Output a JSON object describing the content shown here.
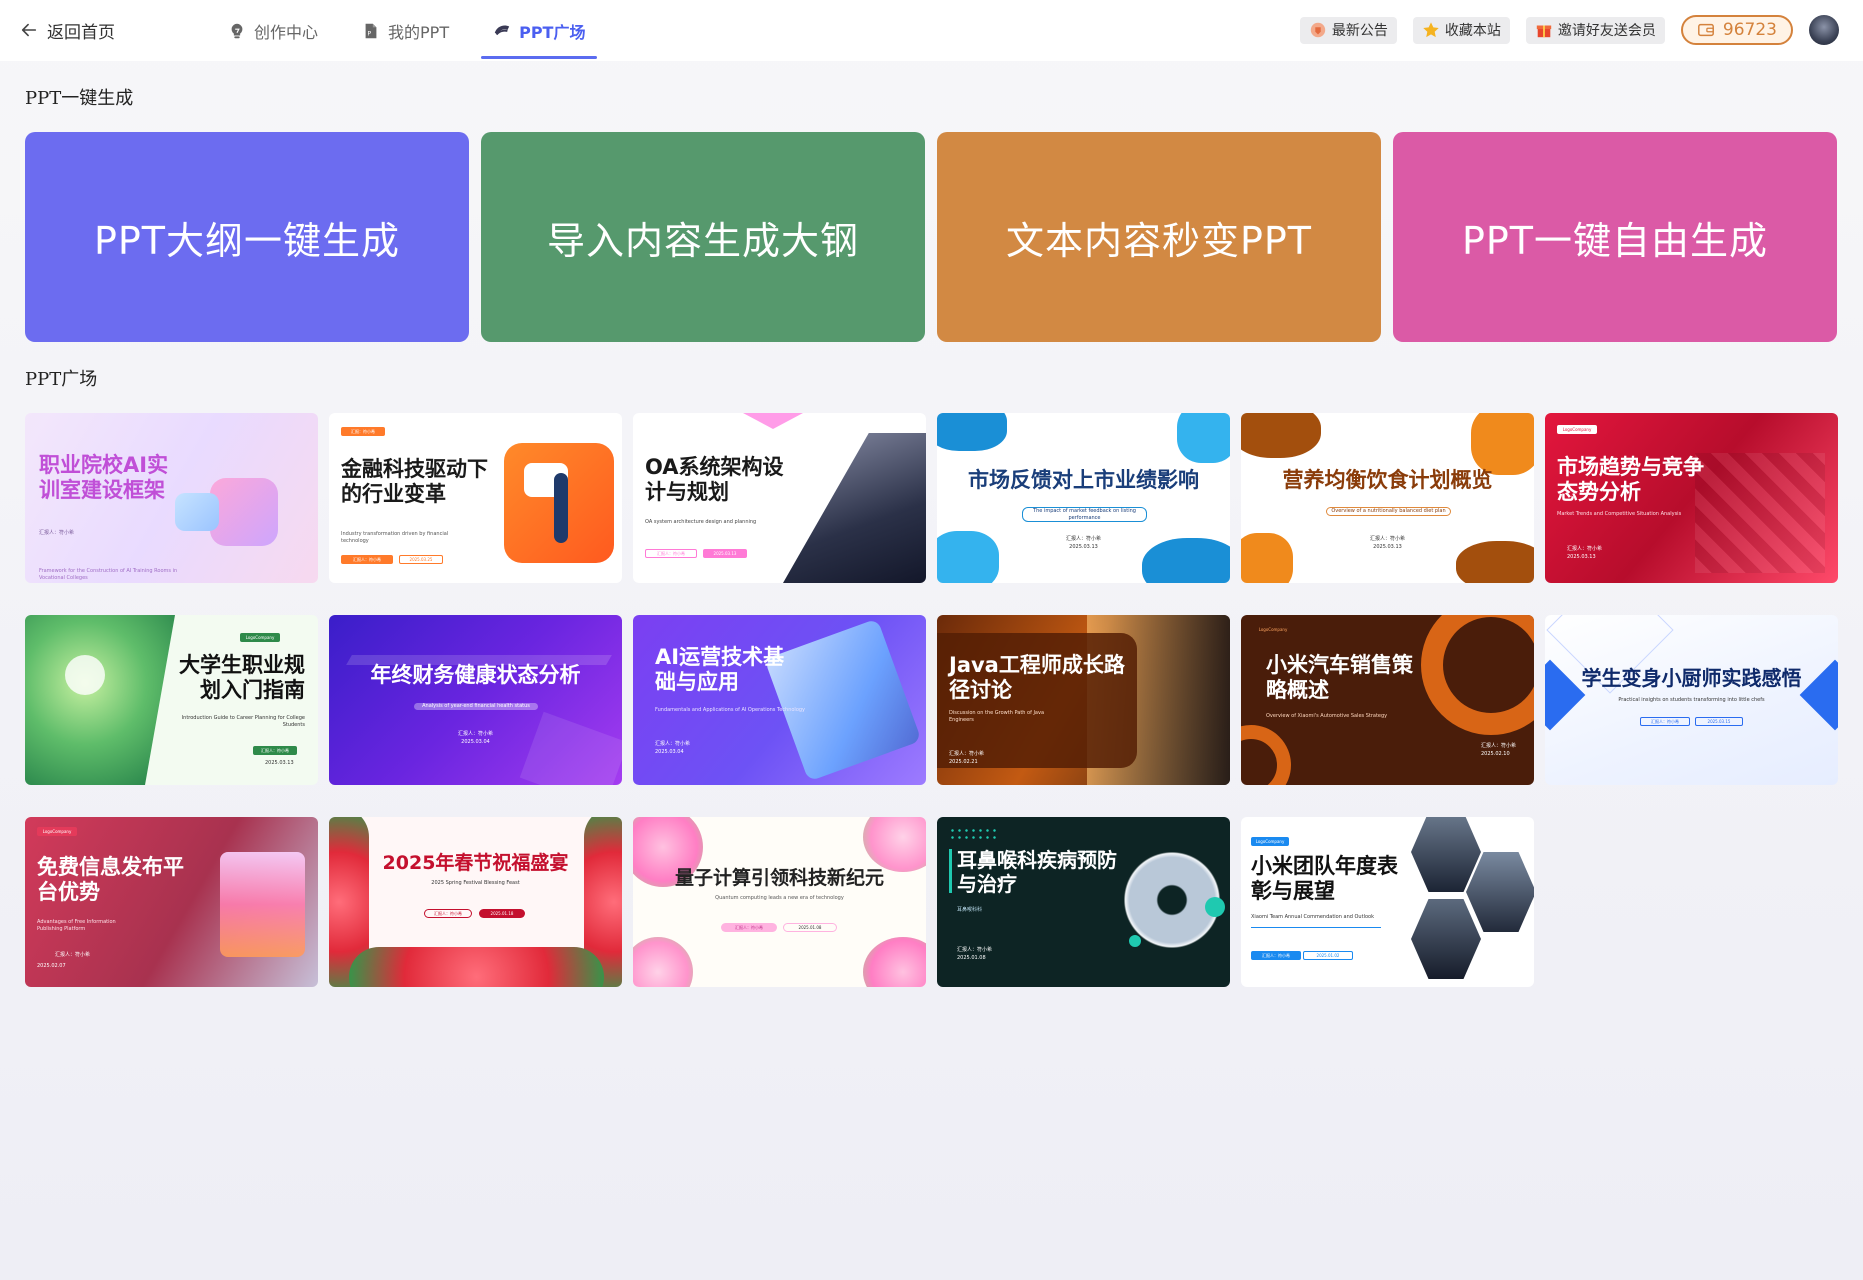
{
  "topbar": {
    "back_label": "返回首页",
    "nav": [
      {
        "label": "创作中心",
        "icon": "bulb-icon",
        "active": false
      },
      {
        "label": "我的PPT",
        "icon": "document-icon",
        "active": false
      },
      {
        "label": "PPT广场",
        "icon": "square-icon",
        "active": true
      }
    ],
    "tools": [
      {
        "label": "最新公告",
        "icon": "announcement-icon"
      },
      {
        "label": "收藏本站",
        "icon": "star-icon"
      },
      {
        "label": "邀请好友送会员",
        "icon": "gift-icon"
      }
    ],
    "points": "96723"
  },
  "generate_section": {
    "title": "PPT一键生成",
    "cards": [
      {
        "label": "PPT大纲一键生成",
        "color": "#6c6cf0"
      },
      {
        "label": "导入内容生成大钢",
        "color": "#56996d"
      },
      {
        "label": "文本内容秒变PPT",
        "color": "#d28943"
      },
      {
        "label": "PPT一键自由生成",
        "color": "#db5aa6"
      }
    ]
  },
  "square_section": {
    "title": "PPT广场",
    "templates": [
      {
        "title": "职业院校AI实训室建设框架",
        "subtitle": "Framework for the Construction of AI Training Rooms in Vocational Colleges",
        "reporter": "汇报人：符小希",
        "date": ""
      },
      {
        "title": "金融科技驱动下的行业变革",
        "subtitle": "Industry transformation driven by financial technology",
        "tag": "汇报：符小希",
        "reporter": "汇报人：符小希",
        "date": "2025.03.25"
      },
      {
        "title": "OA系统架构设计与规划",
        "subtitle": "OA system architecture design and planning",
        "reporter": "汇报人：符小希",
        "date": "2025.03.13"
      },
      {
        "title": "市场反馈对上市业绩影响",
        "subtitle": "The impact of market feedback on listing performance",
        "reporter": "汇报人：符小希",
        "date": "2025.03.13"
      },
      {
        "title": "营养均衡饮食计划概览",
        "subtitle": "Overview of a nutritionally balanced diet plan",
        "reporter": "汇报人：符小希",
        "date": "2025.03.13"
      },
      {
        "title": "市场趋势与竞争态势分析",
        "subtitle": "Market Trends and Competitive Situation Analysis",
        "logo": "LogoCompany",
        "reporter": "汇报人：符小希",
        "date": "2025.03.13"
      },
      {
        "title": "大学生职业规划入门指南",
        "subtitle": "Introduction Guide to Career Planning for College Students",
        "logo": "LogoCompany",
        "reporter": "汇报人：符小希",
        "date": "2025.03.13"
      },
      {
        "title": "年终财务健康状态分析",
        "subtitle": "Analysis of year-end financial health status",
        "reporter": "汇报人：符小希",
        "date": "2025.03.04"
      },
      {
        "title": "AI运营技术基础与应用",
        "subtitle": "Fundamentals and Applications of AI Operations Technology",
        "reporter": "汇报人：符小希",
        "date": "2025.03.04"
      },
      {
        "title": "Java工程师成长路径讨论",
        "subtitle": "Discussion on the Growth Path of Java Engineers",
        "reporter": "汇报人：符小希",
        "date": "2025.02.21"
      },
      {
        "title": "小米汽车销售策略概述",
        "subtitle": "Overview of Xiaomi's Automotive Sales Strategy",
        "logo": "LogoCompany",
        "reporter": "汇报人：符小希",
        "date": "2025.02.10"
      },
      {
        "title": "学生变身小厨师实践感悟",
        "subtitle": "Practical insights on students transforming into little chefs",
        "reporter": "汇报人：符小希",
        "date": "2025.03.15"
      },
      {
        "title": "免费信息发布平台优势",
        "subtitle": "Advantages of Free Information Publishing Platform",
        "logo": "LogoCompany",
        "reporter": "汇报人：符小希",
        "date": "2025.02.07"
      },
      {
        "title": "2025年春节祝福盛宴",
        "subtitle": "2025 Spring Festival Blessing Feast",
        "reporter": "汇报人：符小希",
        "date": "2025.01.18"
      },
      {
        "title": "量子计算引领科技新纪元",
        "subtitle": "Quantum computing leads a new era of technology",
        "reporter": "汇报人：符小希",
        "date": "2025.01.08"
      },
      {
        "title": "耳鼻喉科疾病预防与治疗",
        "subtitle": "耳鼻喉科科",
        "reporter": "汇报人：符小希",
        "date": "2025.01.08"
      },
      {
        "title": "小米团队年度表彰与展望",
        "subtitle": "Xiaomi Team Annual Commendation and Outlook",
        "logo": "LogoCompany",
        "reporter": "汇报人：符小希",
        "date": "2025.01.02"
      }
    ]
  }
}
